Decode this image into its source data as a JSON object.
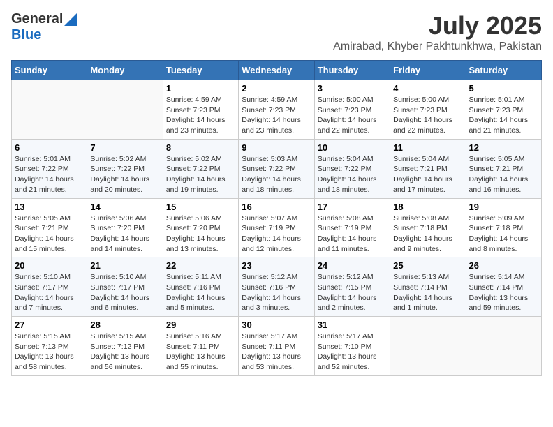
{
  "header": {
    "logo_general": "General",
    "logo_blue": "Blue",
    "month_year": "July 2025",
    "location": "Amirabad, Khyber Pakhtunkhwa, Pakistan"
  },
  "days_of_week": [
    "Sunday",
    "Monday",
    "Tuesday",
    "Wednesday",
    "Thursday",
    "Friday",
    "Saturday"
  ],
  "weeks": [
    [
      {
        "day": "",
        "info": ""
      },
      {
        "day": "",
        "info": ""
      },
      {
        "day": "1",
        "info": "Sunrise: 4:59 AM\nSunset: 7:23 PM\nDaylight: 14 hours and 23 minutes."
      },
      {
        "day": "2",
        "info": "Sunrise: 4:59 AM\nSunset: 7:23 PM\nDaylight: 14 hours and 23 minutes."
      },
      {
        "day": "3",
        "info": "Sunrise: 5:00 AM\nSunset: 7:23 PM\nDaylight: 14 hours and 22 minutes."
      },
      {
        "day": "4",
        "info": "Sunrise: 5:00 AM\nSunset: 7:23 PM\nDaylight: 14 hours and 22 minutes."
      },
      {
        "day": "5",
        "info": "Sunrise: 5:01 AM\nSunset: 7:23 PM\nDaylight: 14 hours and 21 minutes."
      }
    ],
    [
      {
        "day": "6",
        "info": "Sunrise: 5:01 AM\nSunset: 7:22 PM\nDaylight: 14 hours and 21 minutes."
      },
      {
        "day": "7",
        "info": "Sunrise: 5:02 AM\nSunset: 7:22 PM\nDaylight: 14 hours and 20 minutes."
      },
      {
        "day": "8",
        "info": "Sunrise: 5:02 AM\nSunset: 7:22 PM\nDaylight: 14 hours and 19 minutes."
      },
      {
        "day": "9",
        "info": "Sunrise: 5:03 AM\nSunset: 7:22 PM\nDaylight: 14 hours and 18 minutes."
      },
      {
        "day": "10",
        "info": "Sunrise: 5:04 AM\nSunset: 7:22 PM\nDaylight: 14 hours and 18 minutes."
      },
      {
        "day": "11",
        "info": "Sunrise: 5:04 AM\nSunset: 7:21 PM\nDaylight: 14 hours and 17 minutes."
      },
      {
        "day": "12",
        "info": "Sunrise: 5:05 AM\nSunset: 7:21 PM\nDaylight: 14 hours and 16 minutes."
      }
    ],
    [
      {
        "day": "13",
        "info": "Sunrise: 5:05 AM\nSunset: 7:21 PM\nDaylight: 14 hours and 15 minutes."
      },
      {
        "day": "14",
        "info": "Sunrise: 5:06 AM\nSunset: 7:20 PM\nDaylight: 14 hours and 14 minutes."
      },
      {
        "day": "15",
        "info": "Sunrise: 5:06 AM\nSunset: 7:20 PM\nDaylight: 14 hours and 13 minutes."
      },
      {
        "day": "16",
        "info": "Sunrise: 5:07 AM\nSunset: 7:19 PM\nDaylight: 14 hours and 12 minutes."
      },
      {
        "day": "17",
        "info": "Sunrise: 5:08 AM\nSunset: 7:19 PM\nDaylight: 14 hours and 11 minutes."
      },
      {
        "day": "18",
        "info": "Sunrise: 5:08 AM\nSunset: 7:18 PM\nDaylight: 14 hours and 9 minutes."
      },
      {
        "day": "19",
        "info": "Sunrise: 5:09 AM\nSunset: 7:18 PM\nDaylight: 14 hours and 8 minutes."
      }
    ],
    [
      {
        "day": "20",
        "info": "Sunrise: 5:10 AM\nSunset: 7:17 PM\nDaylight: 14 hours and 7 minutes."
      },
      {
        "day": "21",
        "info": "Sunrise: 5:10 AM\nSunset: 7:17 PM\nDaylight: 14 hours and 6 minutes."
      },
      {
        "day": "22",
        "info": "Sunrise: 5:11 AM\nSunset: 7:16 PM\nDaylight: 14 hours and 5 minutes."
      },
      {
        "day": "23",
        "info": "Sunrise: 5:12 AM\nSunset: 7:16 PM\nDaylight: 14 hours and 3 minutes."
      },
      {
        "day": "24",
        "info": "Sunrise: 5:12 AM\nSunset: 7:15 PM\nDaylight: 14 hours and 2 minutes."
      },
      {
        "day": "25",
        "info": "Sunrise: 5:13 AM\nSunset: 7:14 PM\nDaylight: 14 hours and 1 minute."
      },
      {
        "day": "26",
        "info": "Sunrise: 5:14 AM\nSunset: 7:14 PM\nDaylight: 13 hours and 59 minutes."
      }
    ],
    [
      {
        "day": "27",
        "info": "Sunrise: 5:15 AM\nSunset: 7:13 PM\nDaylight: 13 hours and 58 minutes."
      },
      {
        "day": "28",
        "info": "Sunrise: 5:15 AM\nSunset: 7:12 PM\nDaylight: 13 hours and 56 minutes."
      },
      {
        "day": "29",
        "info": "Sunrise: 5:16 AM\nSunset: 7:11 PM\nDaylight: 13 hours and 55 minutes."
      },
      {
        "day": "30",
        "info": "Sunrise: 5:17 AM\nSunset: 7:11 PM\nDaylight: 13 hours and 53 minutes."
      },
      {
        "day": "31",
        "info": "Sunrise: 5:17 AM\nSunset: 7:10 PM\nDaylight: 13 hours and 52 minutes."
      },
      {
        "day": "",
        "info": ""
      },
      {
        "day": "",
        "info": ""
      }
    ]
  ]
}
